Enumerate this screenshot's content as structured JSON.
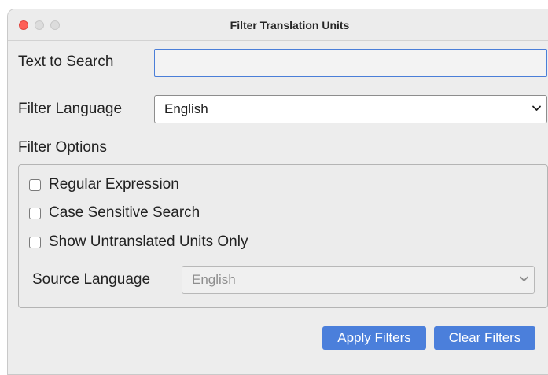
{
  "window": {
    "title": "Filter Translation Units"
  },
  "search": {
    "label": "Text to Search",
    "value": ""
  },
  "filter_language": {
    "label": "Filter Language",
    "selected": "English"
  },
  "filter_options": {
    "label": "Filter Options",
    "checkboxes": [
      {
        "label": "Regular Expression",
        "checked": false
      },
      {
        "label": "Case Sensitive Search",
        "checked": false
      },
      {
        "label": "Show Untranslated Units Only",
        "checked": false
      }
    ],
    "source_language": {
      "label": "Source Language",
      "selected": "English",
      "enabled": false
    }
  },
  "buttons": {
    "apply": "Apply Filters",
    "clear": "Clear Filters"
  },
  "colors": {
    "accent": "#4b7fdb",
    "close_button": "#fe5f57",
    "window_bg": "#ededed"
  }
}
